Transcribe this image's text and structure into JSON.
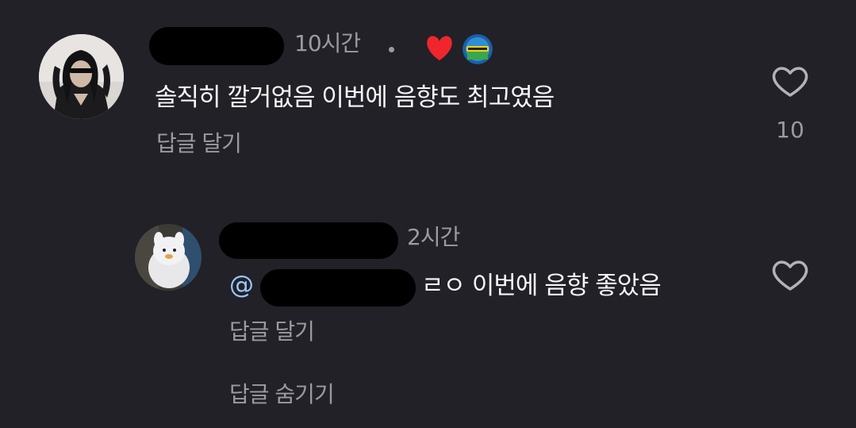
{
  "comments": [
    {
      "time": "10시간",
      "text": "솔직히 깔거없음 이번에 음향도 최고였음",
      "reply_action": "답글 달기",
      "like_count": "10",
      "icons": {
        "avatar": "profile-avatar-woman-sunglasses",
        "heart": "heart-icon",
        "badge": "fan-badge-icon",
        "like": "like-heart-outline-icon"
      },
      "colors": {
        "heart": "#f0262c"
      }
    }
  ],
  "replies": [
    {
      "time": "2시간",
      "mention_symbol": "@",
      "text": "ㄹㅇ 이번에 음향 좋았음",
      "reply_action": "답글 달기",
      "icons": {
        "avatar": "profile-avatar-plush-toy",
        "like": "like-heart-outline-icon"
      }
    }
  ],
  "hide_replies_action": "답글 숨기기",
  "colors": {
    "background": "#212127",
    "text_primary": "#f6f6f8",
    "text_secondary": "#9a9aa1",
    "mention": "#9bc6ff",
    "redaction": "#000000"
  }
}
